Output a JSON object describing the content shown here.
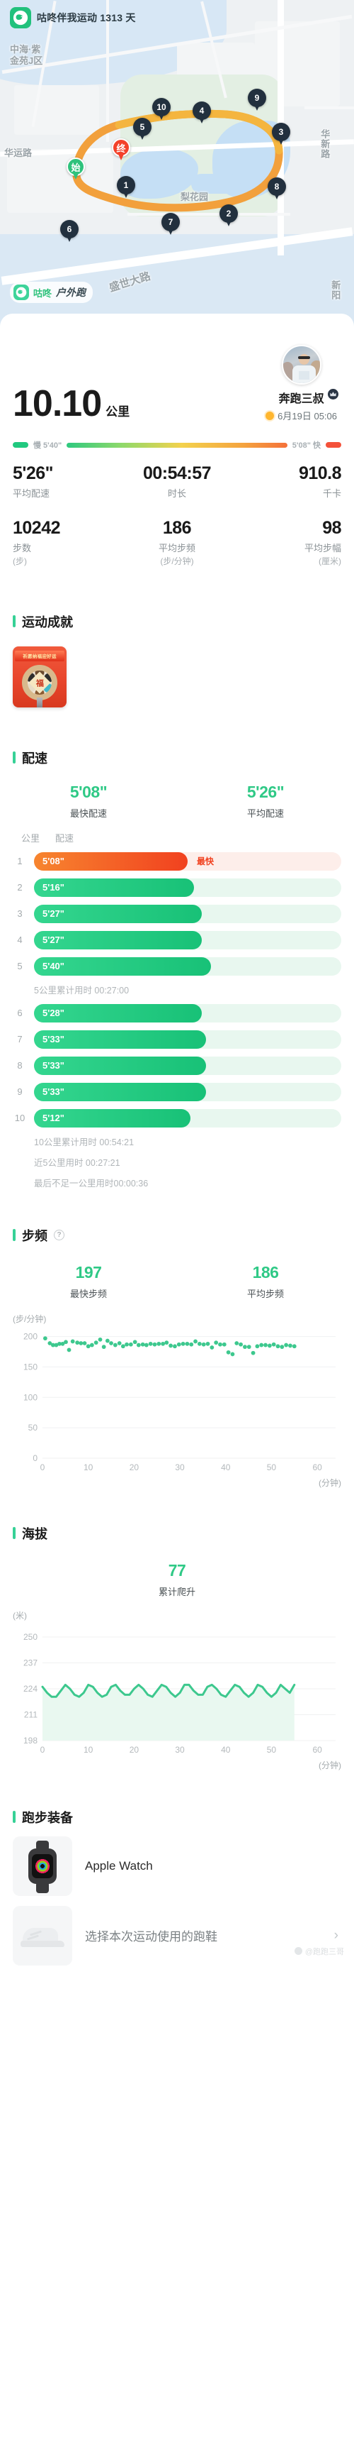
{
  "app": {
    "badge_text": "咕咚伴我运动 1313 天",
    "brand": "咕咚",
    "activity_type": "户外跑",
    "icon_name": "codoon-logo-icon"
  },
  "map": {
    "labels": [
      {
        "text": "中海·紫",
        "name": "map-label-zhonghai1"
      },
      {
        "text": "金苑J区",
        "name": "map-label-zhonghai2"
      },
      {
        "text": "华运路",
        "name": "map-label-huayun"
      },
      {
        "text": "梨花园",
        "name": "map-label-lihuayuan"
      },
      {
        "text": "盛世大路",
        "name": "map-label-shengshi"
      },
      {
        "text": "华新路",
        "name": "map-label-huaxin"
      },
      {
        "text": "新阳",
        "name": "map-label-xinyang"
      }
    ],
    "start_marker": "始",
    "end_marker": "终",
    "km_markers": [
      "1",
      "2",
      "3",
      "4",
      "5",
      "6",
      "7",
      "8",
      "9",
      "10"
    ]
  },
  "summary": {
    "distance": "10.10",
    "distance_unit": "公里",
    "user_name": "奔跑三叔",
    "date": "6月19日 05:06",
    "weather_icon": "sun-icon"
  },
  "pace_strip": {
    "slow_label": "慢 5'40\"",
    "fast_label": "5'08\" 快"
  },
  "stats_primary": [
    {
      "value": "5'26\"",
      "label": "平均配速",
      "unit": ""
    },
    {
      "value": "00:54:57",
      "label": "时长",
      "unit": ""
    },
    {
      "value": "910.8",
      "label": "千卡",
      "unit": ""
    }
  ],
  "stats_secondary": [
    {
      "value": "10242",
      "label": "步数",
      "unit": "(步)"
    },
    {
      "value": "186",
      "label": "平均步频",
      "unit": "(步/分钟)"
    },
    {
      "value": "98",
      "label": "平均步幅",
      "unit": "(厘米)"
    }
  ],
  "sections": {
    "achievement": "运动成就",
    "pace": "配速",
    "cadence": "步频",
    "elevation": "海拔",
    "gear": "跑步装备"
  },
  "achievement": {
    "medal_ribbon": "祈愿纳福迎好运",
    "medal_center": "福"
  },
  "pace_section": {
    "fastest_value": "5'08\"",
    "fastest_label": "最快配速",
    "average_value": "5'26\"",
    "average_label": "平均配速",
    "col_km": "公里",
    "col_pace": "配速",
    "fastest_tag": "最快",
    "note_5km": "5公里累计用时 00:27:00",
    "note_10km": "10公里累计用时 00:54:21",
    "note_last5": "近5公里用时 00:27:21",
    "note_partial": "最后不足一公里用时00:00:36"
  },
  "cadence_section": {
    "max_value": "197",
    "max_label": "最快步频",
    "avg_value": "186",
    "avg_label": "平均步频",
    "y_unit": "(步/分钟)",
    "x_unit": "(分钟)"
  },
  "elevation_section": {
    "gain_value": "77",
    "gain_label": "累计爬升",
    "y_unit": "(米)",
    "x_unit": "(分钟)"
  },
  "gear": [
    {
      "label": "Apple Watch",
      "icon": "apple-watch-icon",
      "has_chevron": false,
      "placeholder": false
    },
    {
      "label": "选择本次运动使用的跑鞋",
      "icon": "running-shoe-icon",
      "has_chevron": true,
      "placeholder": true
    }
  ],
  "watermark": "@跑跑三哥",
  "colors": {
    "accent_green": "#2fc986",
    "accent_orange": "#f1411f",
    "route": "#f2a03c",
    "text_dark": "#1b1b1b",
    "text_muted": "#a5abae"
  },
  "chart_data": [
    {
      "type": "scatter",
      "title": "步频",
      "xlabel": "(分钟)",
      "ylabel": "(步/分钟)",
      "xlim": [
        0,
        64
      ],
      "ylim": [
        0,
        210
      ],
      "xticks": [
        0,
        10,
        20,
        30,
        40,
        50,
        60
      ],
      "yticks": [
        0,
        50,
        100,
        150,
        200
      ],
      "grid": true,
      "series": [
        {
          "name": "步频",
          "color": "#3dc88e",
          "x": [
            0.6,
            1.6,
            2.3,
            3.0,
            3.7,
            4.4,
            5.1,
            5.8,
            6.6,
            7.6,
            8.4,
            9.2,
            10.0,
            10.8,
            11.7,
            12.6,
            13.4,
            14.2,
            15.0,
            15.9,
            16.8,
            17.6,
            18.4,
            19.3,
            20.2,
            21.0,
            21.9,
            22.7,
            23.6,
            24.5,
            25.4,
            26.3,
            27.1,
            28.0,
            28.9,
            29.8,
            30.7,
            31.6,
            32.5,
            33.4,
            34.3,
            35.2,
            36.1,
            37.0,
            37.9,
            38.8,
            39.7,
            40.6,
            41.5,
            42.4,
            43.3,
            44.2,
            45.1,
            46.0,
            46.9,
            47.8,
            48.7,
            49.6,
            50.5,
            51.4,
            52.3,
            53.2,
            54.1,
            55.0
          ],
          "y": [
            197,
            189,
            186,
            186,
            188,
            188,
            191,
            178,
            192,
            190,
            189,
            189,
            184,
            186,
            190,
            195,
            183,
            193,
            189,
            186,
            189,
            184,
            187,
            187,
            191,
            186,
            187,
            186,
            188,
            187,
            188,
            188,
            190,
            185,
            184,
            187,
            188,
            188,
            187,
            192,
            188,
            187,
            188,
            182,
            190,
            187,
            187,
            174,
            171,
            189,
            187,
            183,
            183,
            173,
            184,
            186,
            186,
            185,
            187,
            184,
            183,
            186,
            185,
            184
          ]
        }
      ]
    },
    {
      "type": "area",
      "title": "海拔",
      "xlabel": "(分钟)",
      "ylabel": "(米)",
      "xlim": [
        0,
        64
      ],
      "ylim": [
        198,
        255
      ],
      "xticks": [
        0,
        10,
        20,
        30,
        40,
        50,
        60
      ],
      "yticks": [
        198,
        211,
        224,
        237,
        250
      ],
      "grid": true,
      "series": [
        {
          "name": "海拔",
          "color": "#3dc88e",
          "x": [
            0,
            1,
            2,
            3,
            4,
            5,
            6,
            7,
            8,
            9,
            10,
            11,
            12,
            13,
            14,
            15,
            16,
            17,
            18,
            19,
            20,
            21,
            22,
            23,
            24,
            25,
            26,
            27,
            28,
            29,
            30,
            31,
            32,
            33,
            34,
            35,
            36,
            37,
            38,
            39,
            40,
            41,
            42,
            43,
            44,
            45,
            46,
            47,
            48,
            49,
            50,
            51,
            52,
            53,
            54,
            55
          ],
          "y": [
            225,
            222,
            220,
            220,
            223,
            226,
            224,
            221,
            220,
            222,
            226,
            225,
            222,
            220,
            221,
            225,
            226,
            223,
            221,
            221,
            224,
            226,
            224,
            221,
            220,
            223,
            226,
            225,
            222,
            220,
            222,
            226,
            226,
            223,
            221,
            221,
            225,
            226,
            224,
            221,
            220,
            223,
            226,
            225,
            222,
            220,
            222,
            226,
            225,
            222,
            220,
            222,
            226,
            224,
            222,
            226
          ]
        }
      ]
    }
  ]
}
